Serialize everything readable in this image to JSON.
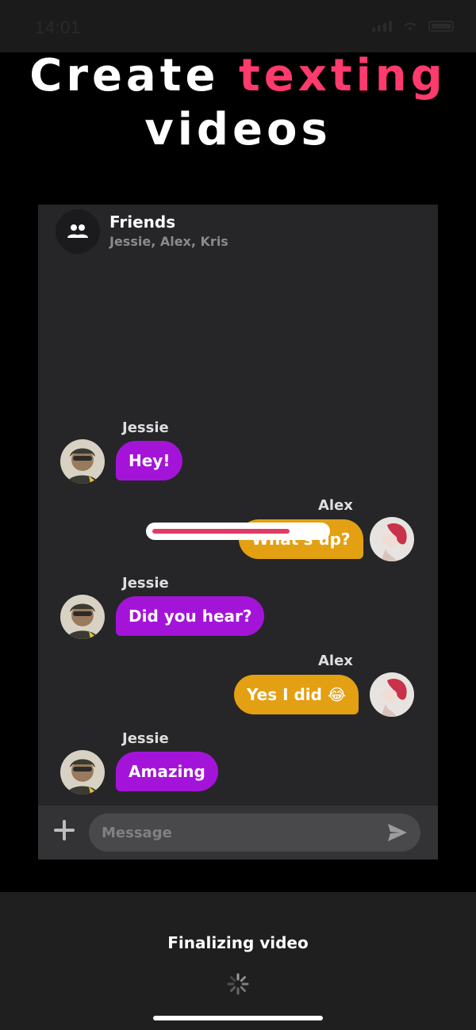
{
  "status": {
    "time": "14:01"
  },
  "headline": {
    "line1_a": "Create ",
    "line1_b": "texting",
    "line2": "videos"
  },
  "chat": {
    "title": "Friends",
    "members": "Jessie, Alex, Kris",
    "messages": [
      {
        "sender": "Jessie",
        "text": "Hey!",
        "side": "left"
      },
      {
        "sender": "Alex",
        "text": "What's up?",
        "side": "right"
      },
      {
        "sender": "Jessie",
        "text": "Did you hear?",
        "side": "left"
      },
      {
        "sender": "Alex",
        "text": "Yes I did 😂",
        "side": "right"
      },
      {
        "sender": "Jessie",
        "text": "Amazing",
        "side": "left"
      }
    ],
    "progress": 0.8,
    "input_placeholder": "Message"
  },
  "sheet": {
    "status": "Finalizing video"
  },
  "colors": {
    "accent": "#ff3a6c",
    "left_bubble": "#a414d8",
    "right_bubble": "#e3a012"
  },
  "icons": [
    "group-icon",
    "plus-icon",
    "send-icon",
    "spinner-icon"
  ]
}
